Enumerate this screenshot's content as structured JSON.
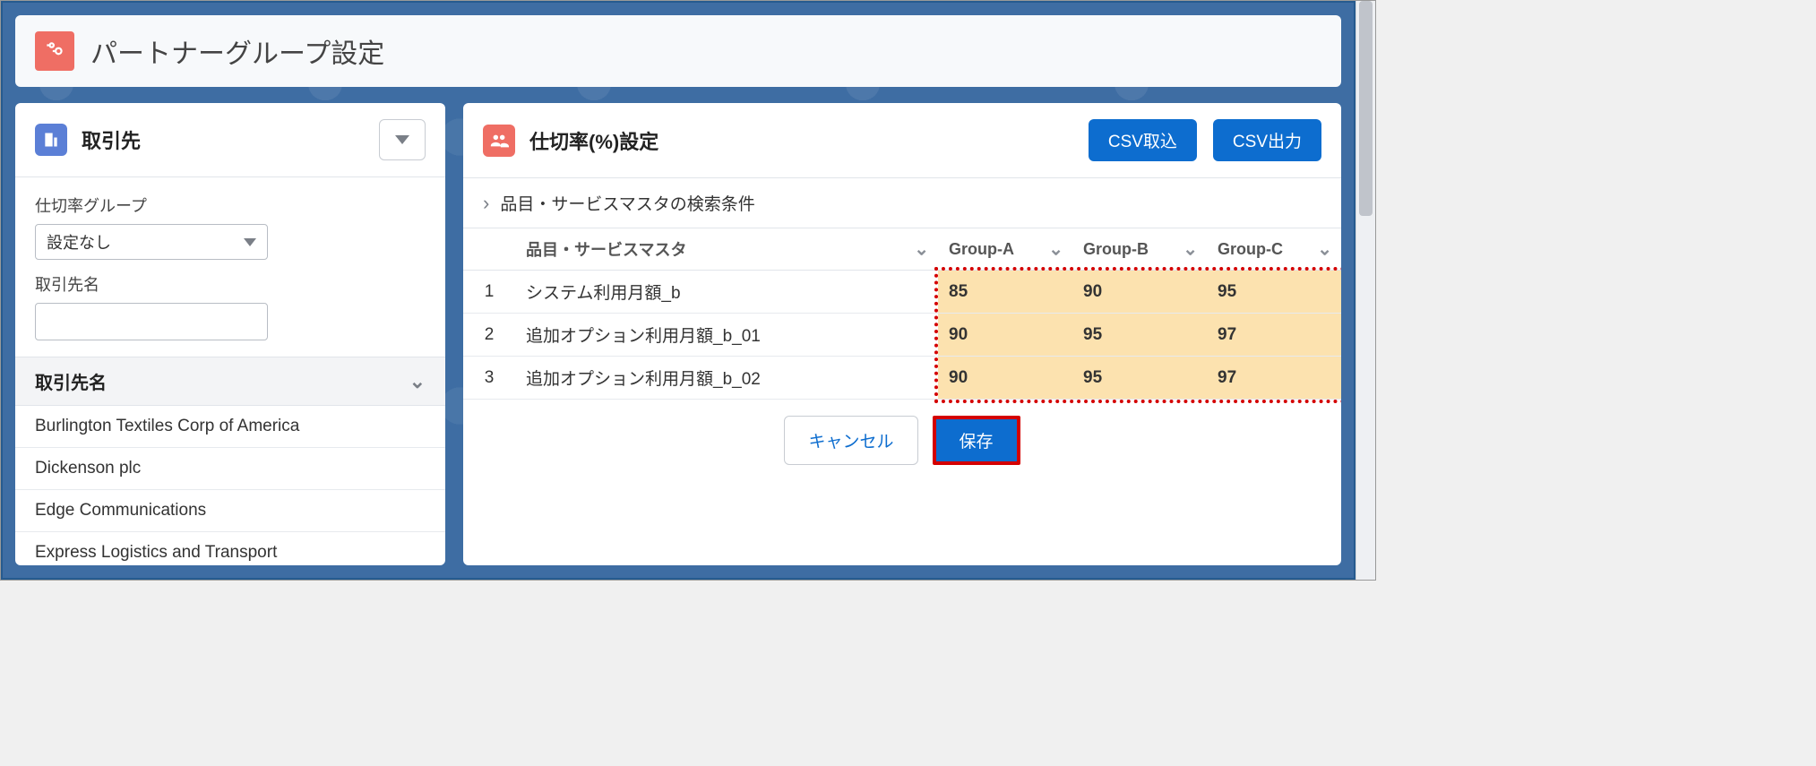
{
  "page_title": "パートナーグループ設定",
  "left": {
    "title": "取引先",
    "filter_group_label": "仕切率グループ",
    "filter_group_value": "設定なし",
    "account_name_label": "取引先名",
    "account_name_value": "",
    "list_header": "取引先名",
    "items": [
      "Burlington Textiles Corp of America",
      "Dickenson plc",
      "Edge Communications",
      "Express Logistics and Transport"
    ]
  },
  "right": {
    "title": "仕切率(%)設定",
    "csv_import": "CSV取込",
    "csv_export": "CSV出力",
    "criteria_label": "品目・サービスマスタの検索条件",
    "columns": {
      "name": "品目・サービスマスタ",
      "g1": "Group-A",
      "g2": "Group-B",
      "g3": "Group-C"
    },
    "footer": {
      "cancel": "キャンセル",
      "save": "保存"
    }
  },
  "chart_data": {
    "type": "table",
    "columns": [
      "#",
      "品目・サービスマスタ",
      "Group-A",
      "Group-B",
      "Group-C"
    ],
    "rows": [
      {
        "idx": "1",
        "name": "システム利用月額_b",
        "g1": "85",
        "g2": "90",
        "g3": "95"
      },
      {
        "idx": "2",
        "name": "追加オプション利用月額_b_01",
        "g1": "90",
        "g2": "95",
        "g3": "97"
      },
      {
        "idx": "3",
        "name": "追加オプション利用月額_b_02",
        "g1": "90",
        "g2": "95",
        "g3": "97"
      }
    ]
  }
}
